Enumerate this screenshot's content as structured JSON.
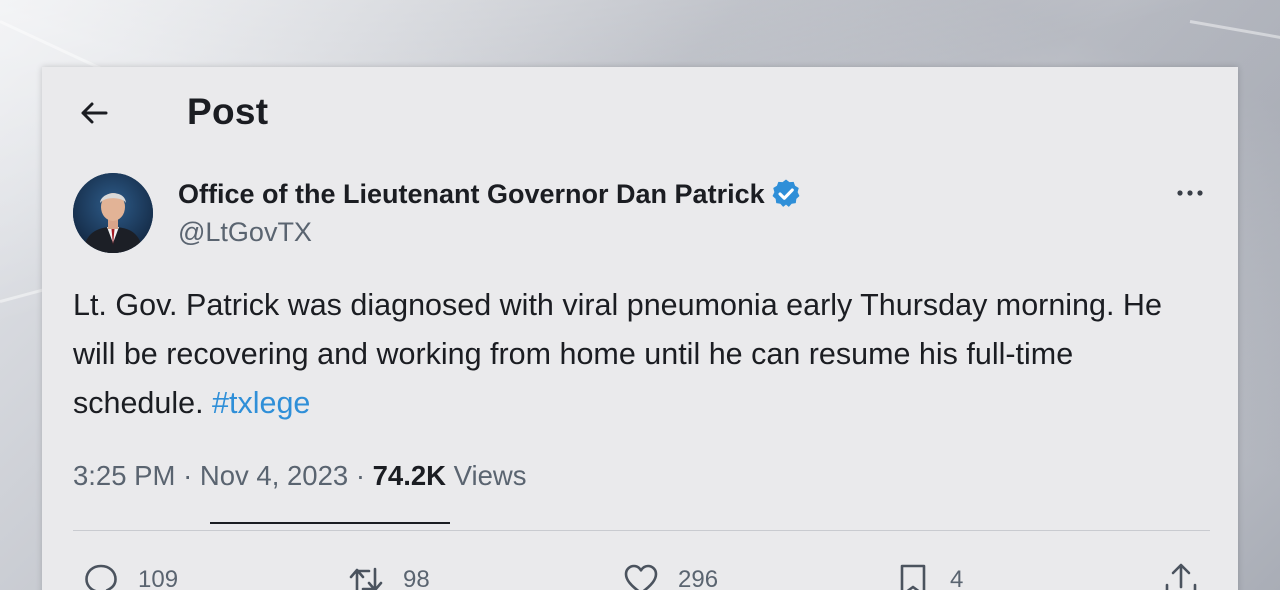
{
  "header": {
    "title": "Post",
    "back_icon": "back-arrow-icon"
  },
  "author": {
    "display_name": "Office of the Lieutenant Governor Dan Patrick",
    "handle": "@LtGovTX",
    "verified_icon": "verified-badge-icon",
    "verified_color": "#2f8fd8"
  },
  "tweet": {
    "text": "Lt. Gov. Patrick was diagnosed with viral pneumonia early Thursday morning. He will be recovering and working from home until he can resume his full-time schedule. ",
    "hashtag": "#txlege",
    "time": "3:25 PM",
    "date": "Nov 4, 2023",
    "separator": "·",
    "views_count": "74.2K",
    "views_label": "Views"
  },
  "actions": {
    "replies": "109",
    "reposts": "98",
    "likes": "296",
    "bookmarks": "4"
  },
  "colors": {
    "accent": "#2f8fd8",
    "text_primary": "#1b1d22",
    "text_secondary": "#5a6470",
    "card_bg": "#eaeaec"
  }
}
